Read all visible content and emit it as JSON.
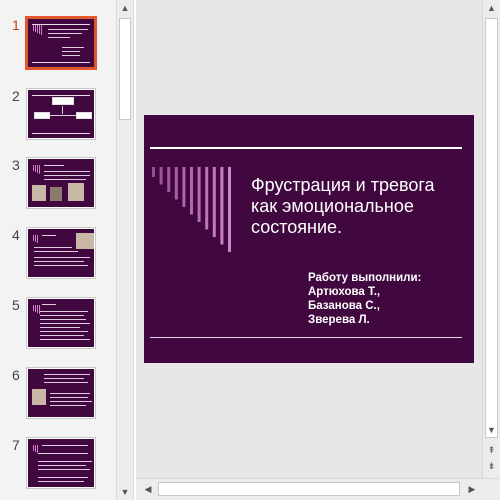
{
  "thumbnails": [
    {
      "number": "1",
      "active": true
    },
    {
      "number": "2",
      "active": false
    },
    {
      "number": "3",
      "active": false
    },
    {
      "number": "4",
      "active": false
    },
    {
      "number": "5",
      "active": false
    },
    {
      "number": "6",
      "active": false
    },
    {
      "number": "7",
      "active": false
    }
  ],
  "slide": {
    "title_lines": [
      "Фрустрация и тревога",
      "как эмоциональное",
      "состояние."
    ],
    "authors": [
      "Работу выполнили:",
      "Артюхова Т.,",
      "Базанова С.,",
      "Зверева Л."
    ],
    "background_color": "#41083f",
    "accent_color": "#d78ad7"
  },
  "icons": {
    "scroll_up": "▲",
    "scroll_down": "▼",
    "scroll_left": "◀",
    "scroll_right": "▶",
    "prev_slide": "⇞",
    "next_slide": "⇟"
  }
}
